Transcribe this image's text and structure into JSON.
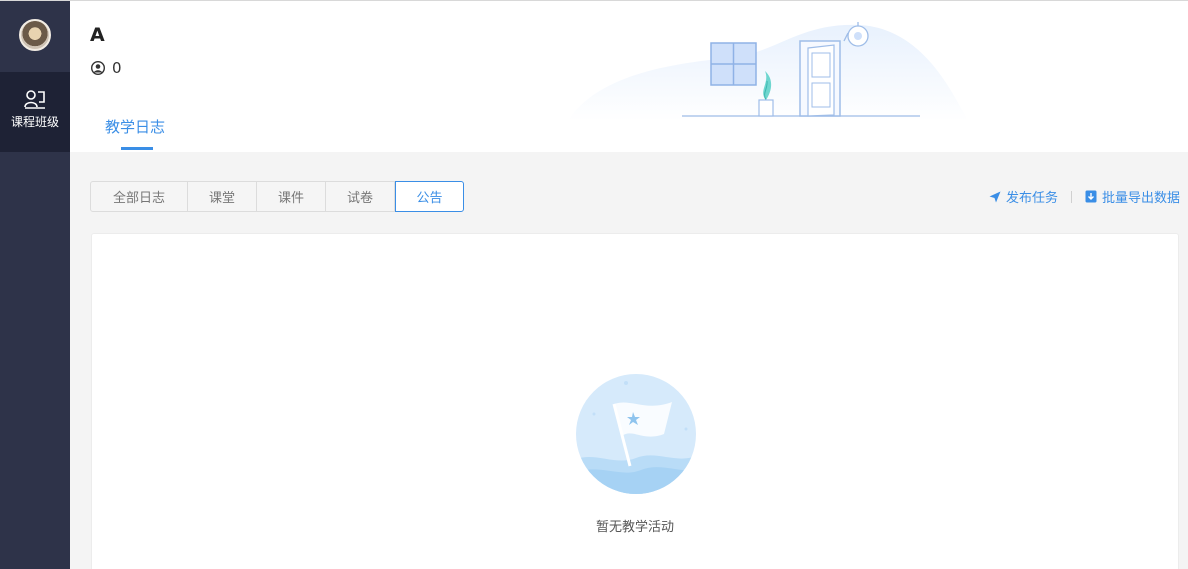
{
  "sidebar": {
    "nav_items": [
      {
        "label": "课程班级",
        "icon": "class-icon"
      }
    ]
  },
  "header": {
    "course_title": "A",
    "member_count": "0",
    "main_tabs": [
      {
        "label": "教学日志",
        "active": true
      }
    ]
  },
  "filters": {
    "tabs": [
      {
        "label": "全部日志",
        "active": false
      },
      {
        "label": "课堂",
        "active": false
      },
      {
        "label": "课件",
        "active": false
      },
      {
        "label": "试卷",
        "active": false
      },
      {
        "label": "公告",
        "active": true
      }
    ]
  },
  "actions": {
    "publish_task": "发布任务",
    "batch_export": "批量导出数据"
  },
  "empty_state": {
    "text": "暂无教学活动"
  },
  "colors": {
    "accent": "#3a8ee6",
    "sidebar_bg": "#2e3349",
    "sidebar_active_bg": "#1e2235"
  }
}
